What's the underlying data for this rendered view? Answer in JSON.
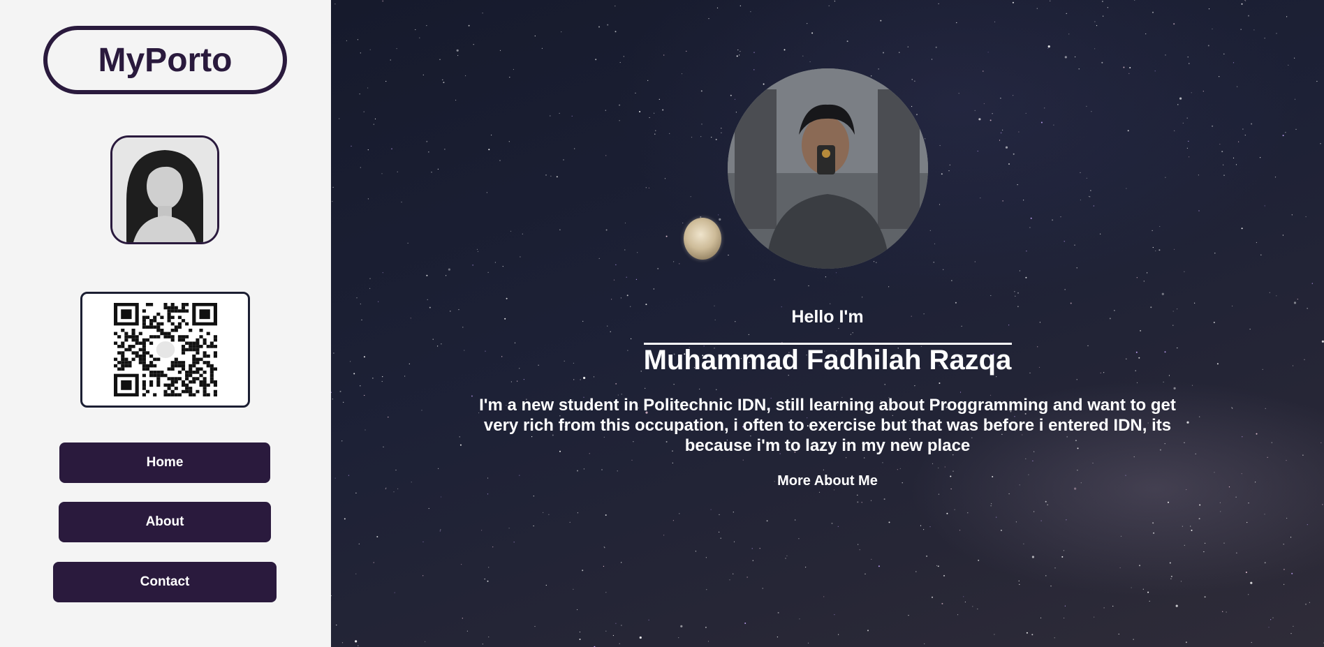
{
  "sidebar": {
    "logo": "MyPorto",
    "nav": [
      {
        "label": "Home"
      },
      {
        "label": "About"
      },
      {
        "label": "Contact"
      }
    ]
  },
  "hero": {
    "greeting": "Hello I'm",
    "name": "Muhammad Fadhilah Razqa",
    "bio": "I'm a new student in Politechnic IDN, still learning about Proggramming and want to get very rich from this occupation, i often to exercise but that was before i entered IDN, its because i'm to lazy in my new place",
    "more_link": "More About Me"
  },
  "colors": {
    "accent": "#2a1a3d",
    "sidebar_bg": "#f4f4f4",
    "text_on_dark": "#ffffff"
  }
}
